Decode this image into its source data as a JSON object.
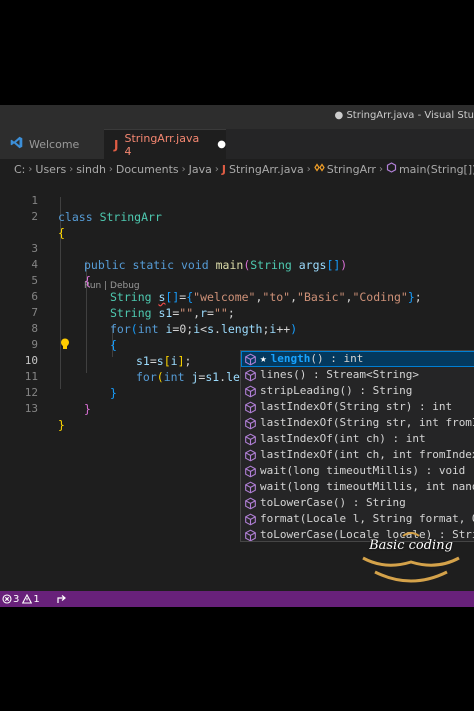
{
  "window": {
    "title": "● StringArr.java - Visual Stu"
  },
  "tabs": [
    {
      "label": "Welcome",
      "icon": "vscode-icon"
    },
    {
      "label": "StringArr.java 4",
      "icon": "java-icon",
      "modified": true
    }
  ],
  "breadcrumb": {
    "items": [
      "C:",
      "Users",
      "sindh",
      "Documents",
      "Java",
      "StringArr.java",
      "StringArr",
      "main(String[])"
    ]
  },
  "codelens": "Run | Debug",
  "code": {
    "line_numbers": [
      "1",
      "2",
      "3",
      "4",
      "5",
      "6",
      "7",
      "8",
      "9",
      "10",
      "11",
      "12",
      "13"
    ],
    "lines": [
      "class StringArr",
      "{",
      "public static void main(String args[])",
      "{",
      "String s[]={\"welcome\",\"to\",\"Basic\",\"Coding\"};",
      "String s1=\"\",r=\"\";",
      "for(int i=0;i<s.length;i++)",
      "{",
      "s1=s[i];",
      "for(int j=s1.len)",
      "}",
      "}",
      "}"
    ]
  },
  "suggestions": [
    {
      "name": "length",
      "sig": "() : int",
      "selected": true
    },
    {
      "name": "lines",
      "sig": "() : Stream<String>"
    },
    {
      "name": "stripLeading",
      "sig": "() : String"
    },
    {
      "name": "lastIndexOf",
      "sig": "(String str) : int"
    },
    {
      "name": "lastIndexOf",
      "sig": "(String str, int fromIn"
    },
    {
      "name": "lastIndexOf",
      "sig": "(int ch) : int"
    },
    {
      "name": "lastIndexOf",
      "sig": "(int ch, int fromIndex"
    },
    {
      "name": "wait",
      "sig": "(long timeoutMillis) : void"
    },
    {
      "name": "wait",
      "sig": "(long timeoutMillis, int nanos"
    },
    {
      "name": "toLowerCase",
      "sig": "() : String"
    },
    {
      "name": "format",
      "sig": "(Locale l, String format, Ob"
    },
    {
      "name": "toLowerCase",
      "sig": "(Locale locale) : Stri"
    }
  ],
  "status": {
    "errors": "3",
    "warnings": "1"
  },
  "watermark": "Basic coding",
  "colors": {
    "status_bar": "#68217a",
    "selection": "#04395e",
    "match_highlight": "#18a3ff",
    "method_icon": "#b180d7"
  }
}
